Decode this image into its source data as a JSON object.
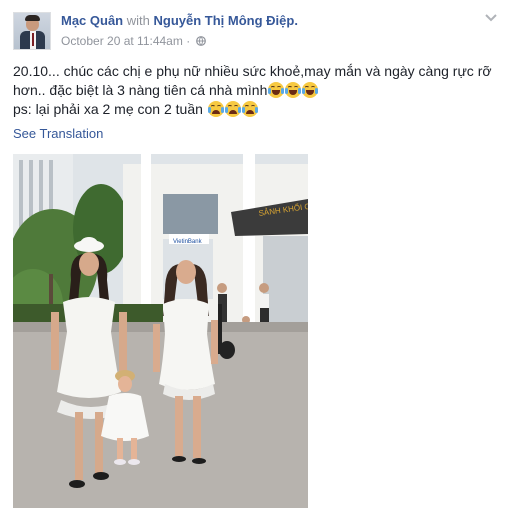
{
  "post": {
    "author": "Mạc Quân",
    "with_text": "with",
    "tagged": "Nguyễn Thị Mông Điệp.",
    "timestamp": "October 20 at 11:44am",
    "separator": "·",
    "privacy_icon": "globe-icon",
    "menu_icon": "chevron-down-icon",
    "body_line1": "20.10... chúc các chị e phụ nữ nhiều sức khoẻ,may mắn và ngày càng rực rỡ hơn.. đặc biệt là 3 nàng tiên cá nhà mình",
    "body_line2": "ps: lại phải xa 2 mẹ con 2 tuần",
    "see_translation": "See Translation",
    "sign_text": "SẢNH KHỐI C",
    "bank_sign": "VietinBank"
  },
  "colors": {
    "link": "#365899",
    "meta": "#90949c",
    "text": "#1d2129"
  }
}
